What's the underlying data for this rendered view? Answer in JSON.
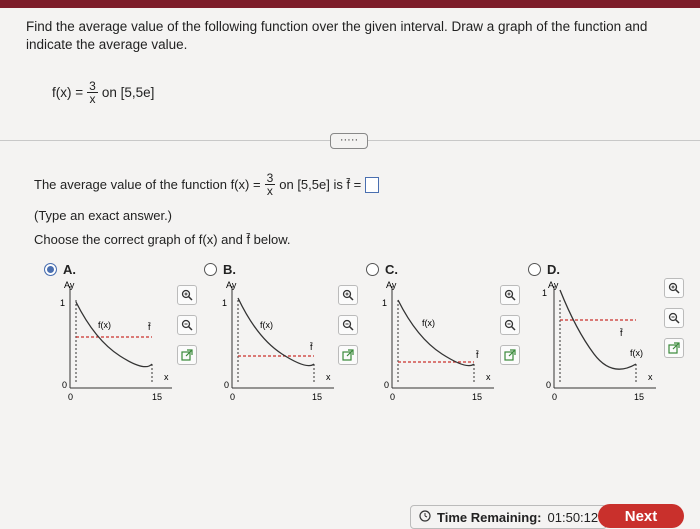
{
  "question": {
    "prompt": "Find the average value of the following function over the given interval. Draw a graph of the function and indicate the average value.",
    "func_lhs": "f(x) =",
    "func_num": "3",
    "func_den": "x",
    "interval": "on [5,5e]"
  },
  "work": {
    "avg_prefix": "The average value of the function f(x) =",
    "avg_num": "3",
    "avg_den": "x",
    "avg_suffix": "on [5,5e] is f̄ =",
    "answer_value": "",
    "hint": "(Type an exact answer.)",
    "choose": "Choose the correct graph of f(x) and f̄ below."
  },
  "options": [
    {
      "label": "A.",
      "selected": true
    },
    {
      "label": "B.",
      "selected": false
    },
    {
      "label": "C.",
      "selected": false
    },
    {
      "label": "D.",
      "selected": false
    }
  ],
  "graphs": [
    {
      "curve_label": "f(x)",
      "avg_label": "f̄",
      "y_tick": "1",
      "x_tick": "15",
      "origin_y": "0",
      "origin_x": "0",
      "x_axis": "x",
      "y_axis": "Ay"
    },
    {
      "curve_label": "f(x)",
      "avg_label": "f̄",
      "y_tick": "1",
      "x_tick": "15",
      "origin_y": "0",
      "origin_x": "0",
      "x_axis": "x",
      "y_axis": "Ay"
    },
    {
      "curve_label": "f(x)",
      "avg_label": "f̄",
      "y_tick": "1",
      "x_tick": "15",
      "origin_y": "0",
      "origin_x": "0",
      "x_axis": "x",
      "y_axis": "Ay"
    },
    {
      "curve_label": "f(x)",
      "avg_label": "f̄",
      "y_tick": "1",
      "x_tick": "15",
      "origin_y": "0",
      "origin_x": "0",
      "x_axis": "x",
      "y_axis": "Ay"
    }
  ],
  "more_button": "·····",
  "footer": {
    "timer_label": "Time Remaining:",
    "timer_value": "01:50:12",
    "next_label": "Next"
  },
  "colors": {
    "accent": "#4a6fb0",
    "next": "#c9302c",
    "top_bar": "#7d1d2a",
    "avg_line": "#c9302c"
  }
}
